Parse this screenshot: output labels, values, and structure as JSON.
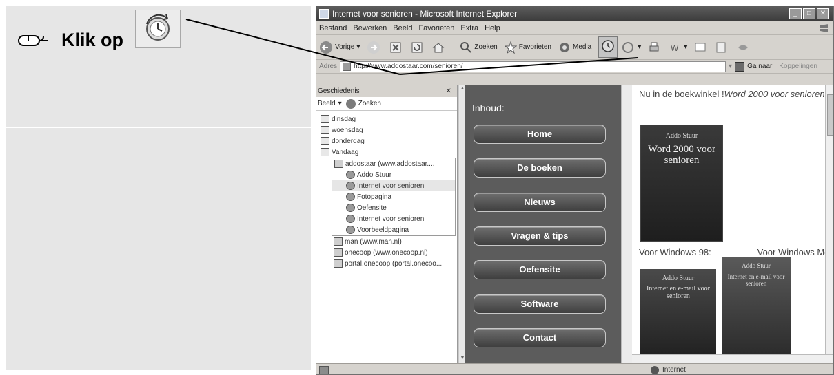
{
  "instruction": {
    "text": "Klik op",
    "mouse_icon": "mouse-icon",
    "button_icon": "history-icon"
  },
  "window": {
    "title": "Internet voor senioren - Microsoft Internet Explorer",
    "controls": [
      "minimize",
      "maximize",
      "close"
    ]
  },
  "menu": [
    "Bestand",
    "Bewerken",
    "Beeld",
    "Favorieten",
    "Extra",
    "Help"
  ],
  "toolbar": {
    "back": "Vorige",
    "search": "Zoeken",
    "favorites": "Favorieten",
    "media": "Media"
  },
  "address": {
    "label": "Adres",
    "url": "http://www.addostaar.com/senioren/",
    "go": "Ga naar",
    "links": "Koppelingen"
  },
  "history": {
    "title": "Geschiedenis",
    "view_label": "Beeld",
    "search_label": "Zoeken",
    "days": [
      "dinsdag",
      "woensdag",
      "donderdag",
      "Vandaag"
    ],
    "site": "addostaar (www.addostaar....",
    "pages": [
      "Addo Stuur",
      "Internet voor senioren",
      "Fotopagina",
      "Oefensite",
      "Internet voor senioren",
      "Voorbeeldpagina"
    ],
    "other_sites": [
      "man (www.man.nl)",
      "onecoop (www.onecoop.nl)",
      "portal.onecoop (portal.onecoo..."
    ]
  },
  "inhoud": {
    "title": "Inhoud:",
    "buttons": [
      "Home",
      "De boeken",
      "Nieuws",
      "Vragen & tips",
      "Oefensite",
      "Software",
      "Contact"
    ]
  },
  "right": {
    "heading": "Nu in de boekwinkel !",
    "heading_italic": "Word 2000 voor senioren",
    "book_author": "Addo Stuur",
    "book_title": "Word 2000 voor senioren",
    "win98_label": "Voor Windows 98:",
    "winme_label": "Voor Windows Me:",
    "book98_author": "Addo Stuur",
    "book98_title": "Internet en e-mail voor senioren",
    "bookme_author": "Addo Stuur",
    "bookme_title": "Internet en e-mail voor senioren"
  },
  "status": {
    "zone": "Internet"
  }
}
